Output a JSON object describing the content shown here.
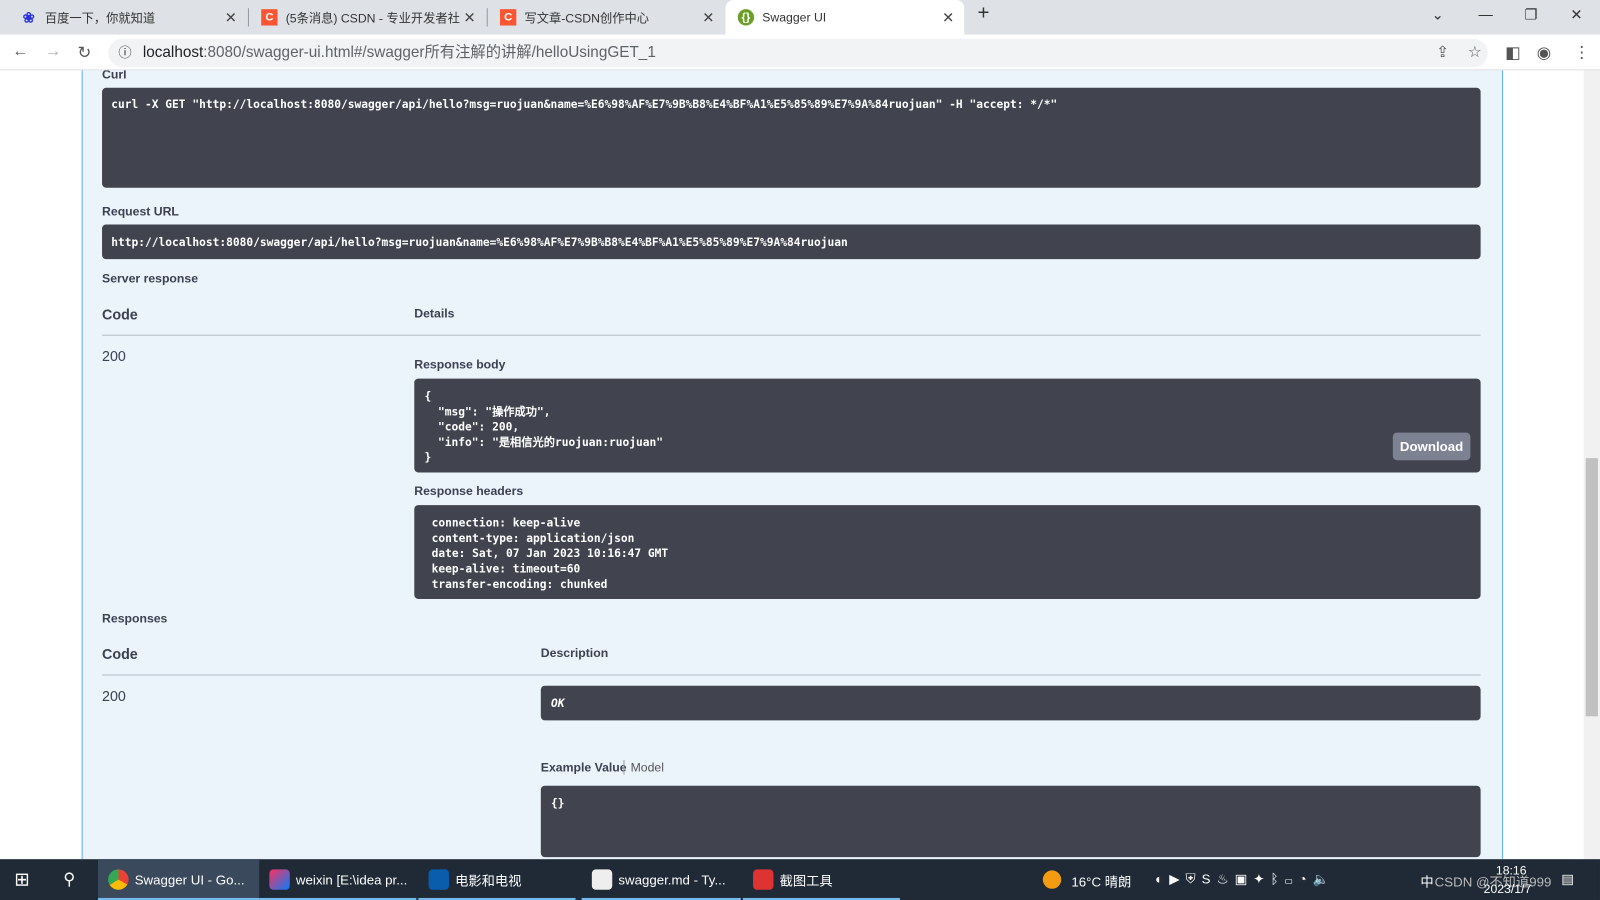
{
  "browser": {
    "tabs": [
      {
        "title": "百度一下，你就知道",
        "icon": "baidu-icon",
        "color": "#2932e1"
      },
      {
        "title": "(5条消息) CSDN - 专业开发者社",
        "icon": "csdn-icon",
        "color": "#fc5531"
      },
      {
        "title": "写文章-CSDN创作中心",
        "icon": "csdn-icon",
        "color": "#fc5531"
      },
      {
        "title": "Swagger UI",
        "icon": "swagger-icon",
        "color": "#6a9f2a",
        "active": true
      }
    ],
    "url_host": "localhost",
    "url_rest": ":8080/swagger-ui.html#/swagger所有注解的讲解/helloUsingGET_1"
  },
  "curl": {
    "label": "Curl",
    "value": "curl -X GET \"http://localhost:8080/swagger/api/hello?msg=ruojuan&name=%E6%98%AF%E7%9B%B8%E4%BF%A1%E5%85%89%E7%9A%84ruojuan\" -H \"accept: */*\""
  },
  "request_url": {
    "label": "Request URL",
    "value": "http://localhost:8080/swagger/api/hello?msg=ruojuan&name=%E6%98%AF%E7%9B%B8%E4%BF%A1%E5%85%89%E7%9A%84ruojuan"
  },
  "server_response": {
    "label": "Server response",
    "code_header": "Code",
    "details_header": "Details",
    "code": "200",
    "body_label": "Response body",
    "body": "{\n  \"msg\": \"操作成功\",\n  \"code\": 200,\n  \"info\": \"是相信光的ruojuan:ruojuan\"\n}",
    "download": "Download",
    "headers_label": "Response headers",
    "headers": "connection: keep-alive\ncontent-type: application/json\ndate: Sat, 07 Jan 2023 10:16:47 GMT\nkeep-alive: timeout=60\ntransfer-encoding: chunked"
  },
  "responses": {
    "label": "Responses",
    "code_header": "Code",
    "desc_header": "Description",
    "code": "200",
    "description": "OK",
    "example_tab": "Example Value",
    "model_tab": "Model",
    "example": "{}"
  },
  "taskbar": {
    "items": [
      "Swagger UI - Go...",
      "weixin [E:\\idea pr...",
      "电影和电视",
      "swagger.md - Ty...",
      "截图工具"
    ],
    "weather": "16°C  晴朗",
    "ime": "中",
    "time": "18:16",
    "date": "2023/1/7",
    "watermark": "CSDN @不知道999"
  }
}
